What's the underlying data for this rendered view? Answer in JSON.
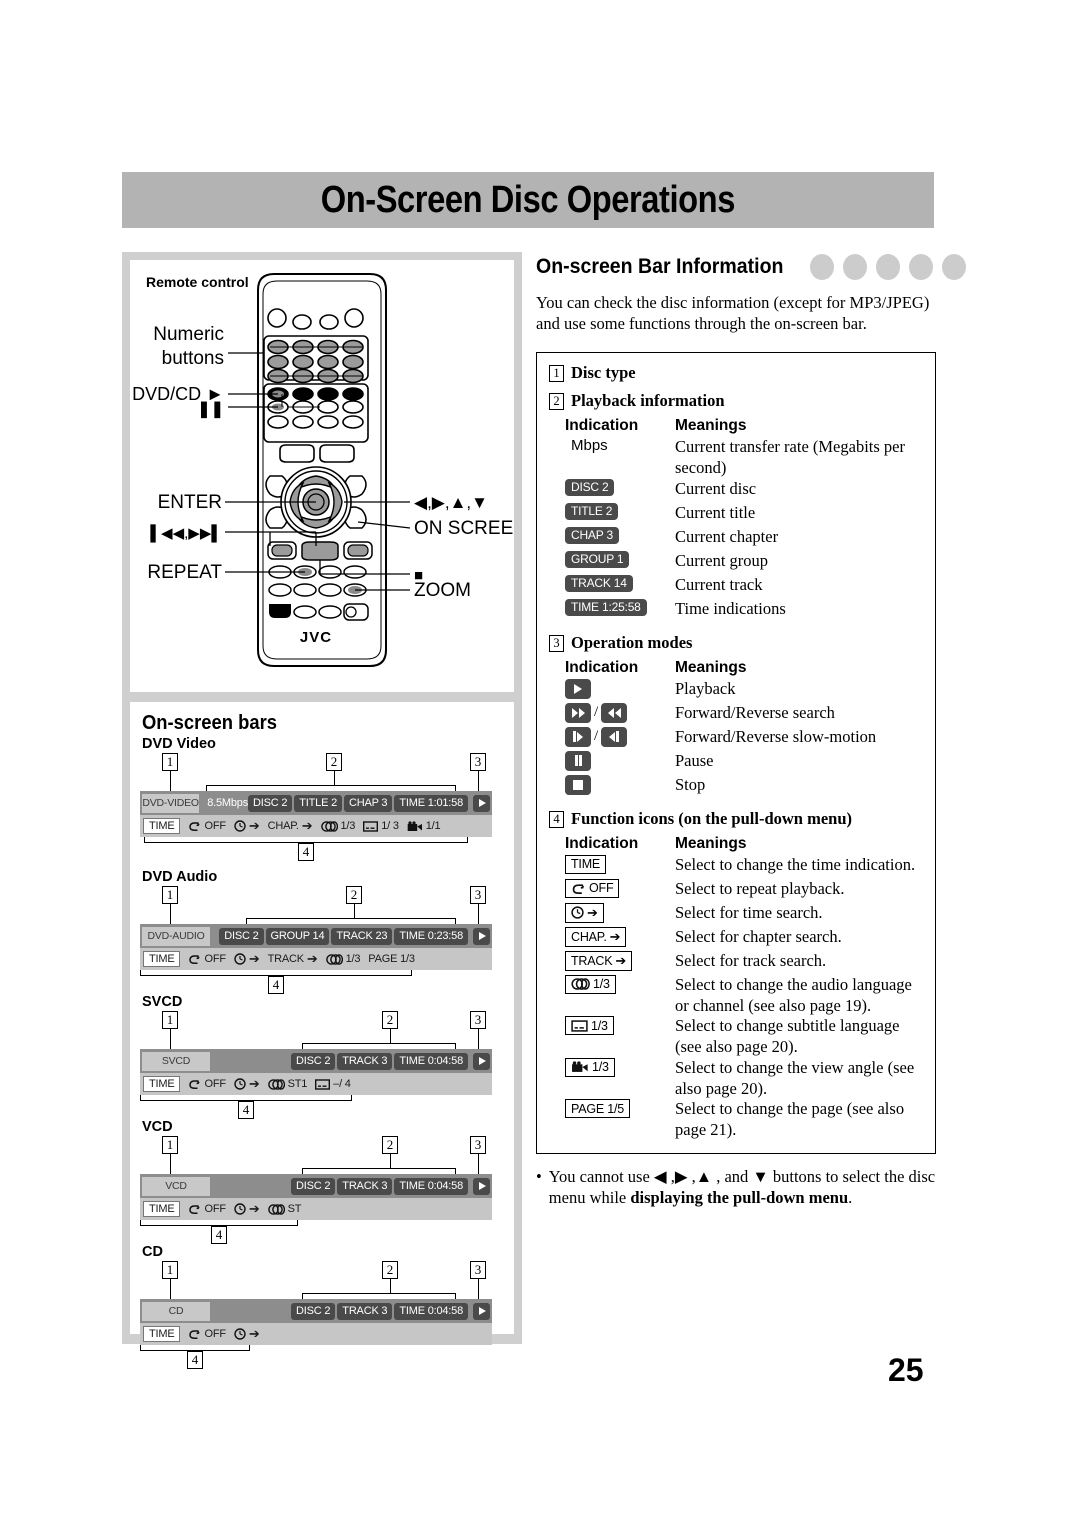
{
  "page": {
    "title": "On-Screen Disc Operations",
    "number": "25"
  },
  "left": {
    "remote": {
      "caption": "Remote control",
      "brand": "JVC",
      "callouts_left": [
        "Numeric",
        "buttons",
        "DVD/CD ▶",
        "❙❙",
        "ENTER",
        "❘◀◀,▶▶❘",
        "REPEAT"
      ],
      "callouts_right": [
        "◀,▶,▲,▼",
        "ON SCREEN",
        "■",
        "ZOOM"
      ]
    },
    "bars_heading": "On-screen bars",
    "bars": [
      {
        "label": "DVD Video",
        "disc_type": "DVD-VIDEO",
        "mbps": "8.5Mbps",
        "playback_chips": [
          "DISC 2",
          "TITLE 2",
          "CHAP 3",
          "TIME   1:01:58"
        ],
        "mode_icon": "play-icon",
        "functions": [
          {
            "icon": "time-icon",
            "text": "TIME",
            "selected": true
          },
          {
            "icon": "repeat-icon",
            "text": "OFF"
          },
          {
            "icon": "clock-arrow-icon",
            "text": ""
          },
          {
            "icon": "chapter-arrow-icon",
            "text": "CHAP."
          },
          {
            "icon": "audio-icon",
            "text": "1/3"
          },
          {
            "icon": "subtitle-icon",
            "text": "1/ 3"
          },
          {
            "icon": "angle-icon",
            "text": "1/1"
          }
        ]
      },
      {
        "label": "DVD Audio",
        "disc_type": "DVD-AUDIO",
        "mbps": "",
        "playback_chips": [
          "DISC 2",
          "GROUP 14",
          "TRACK 23",
          "TIME   0:23:58"
        ],
        "mode_icon": "play-icon",
        "functions": [
          {
            "icon": "time-icon",
            "text": "TIME",
            "selected": true
          },
          {
            "icon": "repeat-icon",
            "text": "OFF"
          },
          {
            "icon": "clock-arrow-icon",
            "text": ""
          },
          {
            "icon": "track-arrow-icon",
            "text": "TRACK"
          },
          {
            "icon": "audio-icon",
            "text": "1/3"
          },
          {
            "icon": "page-icon",
            "text": "PAGE 1/3"
          }
        ]
      },
      {
        "label": "SVCD",
        "disc_type": "SVCD",
        "mbps": "",
        "playback_chips": [
          "DISC 2",
          "TRACK 3",
          "TIME   0:04:58"
        ],
        "mode_icon": "play-icon",
        "functions": [
          {
            "icon": "time-icon",
            "text": "TIME",
            "selected": true
          },
          {
            "icon": "repeat-icon",
            "text": "OFF"
          },
          {
            "icon": "clock-arrow-icon",
            "text": ""
          },
          {
            "icon": "audio-icon",
            "text": "ST1"
          },
          {
            "icon": "subtitle-icon",
            "text": "–/ 4"
          }
        ]
      },
      {
        "label": "VCD",
        "disc_type": "VCD",
        "mbps": "",
        "playback_chips": [
          "DISC 2",
          "TRACK 3",
          "TIME   0:04:58"
        ],
        "mode_icon": "play-icon",
        "functions": [
          {
            "icon": "time-icon",
            "text": "TIME",
            "selected": true
          },
          {
            "icon": "repeat-icon",
            "text": "OFF"
          },
          {
            "icon": "clock-arrow-icon",
            "text": ""
          },
          {
            "icon": "audio-icon",
            "text": "ST"
          }
        ]
      },
      {
        "label": "CD",
        "disc_type": "CD",
        "mbps": "",
        "playback_chips": [
          "DISC 2",
          "TRACK 3",
          "TIME   0:04:58"
        ],
        "mode_icon": "play-icon",
        "functions": [
          {
            "icon": "time-icon",
            "text": "TIME",
            "selected": true
          },
          {
            "icon": "repeat-icon",
            "text": "OFF"
          },
          {
            "icon": "clock-arrow-icon",
            "text": ""
          }
        ]
      }
    ],
    "callout_numbers": {
      "one": "1",
      "two": "2",
      "three": "3",
      "four": "4"
    }
  },
  "right": {
    "heading": "On-screen Bar Information",
    "dots_count": 5,
    "intro": "You can check the disc information (except for MP3/JPEG) and use some functions through the on-screen bar.",
    "sections": [
      {
        "num": "1",
        "title": "Disc type"
      },
      {
        "num": "2",
        "title": "Playback information",
        "col_headers": {
          "indication": "Indication",
          "meanings": "Meanings"
        },
        "rows": [
          {
            "ind_type": "plain",
            "ind": "Mbps",
            "mean": "Current transfer rate (Megabits per second)"
          },
          {
            "ind_type": "chip",
            "ind": "DISC 2",
            "mean": "Current disc"
          },
          {
            "ind_type": "chip",
            "ind": "TITLE  2",
            "mean": "Current title"
          },
          {
            "ind_type": "chip",
            "ind": "CHAP  3",
            "mean": "Current chapter"
          },
          {
            "ind_type": "chip",
            "ind": "GROUP 1",
            "mean": "Current group"
          },
          {
            "ind_type": "chip",
            "ind": "TRACK 14",
            "mean": "Current track"
          },
          {
            "ind_type": "chip",
            "ind": "TIME 1:25:58",
            "mean": "Time indications"
          }
        ]
      },
      {
        "num": "3",
        "title": "Operation modes",
        "col_headers": {
          "indication": "Indication",
          "meanings": "Meanings"
        },
        "rows": [
          {
            "ind_type": "mode",
            "icon": "play-icon",
            "mean": "Playback"
          },
          {
            "ind_type": "mode",
            "icon": "ffwd-rew-icon",
            "mean": "Forward/Reverse search"
          },
          {
            "ind_type": "mode",
            "icon": "slow-fwd-rev-icon",
            "mean": "Forward/Reverse slow-motion"
          },
          {
            "ind_type": "mode",
            "icon": "pause-icon",
            "mean": "Pause"
          },
          {
            "ind_type": "mode",
            "icon": "stop-icon",
            "mean": "Stop"
          }
        ]
      },
      {
        "num": "4",
        "title": "Function icons (on the pull-down menu)",
        "col_headers": {
          "indication": "Indication",
          "meanings": "Meanings"
        },
        "rows": [
          {
            "ind_type": "fnbox",
            "icon": "time-icon",
            "ind": "TIME",
            "mean": "Select to change the time indication."
          },
          {
            "ind_type": "fnbox",
            "icon": "repeat-icon",
            "ind": "OFF",
            "mean": "Select to repeat playback."
          },
          {
            "ind_type": "fnbox",
            "icon": "clock-arrow-icon",
            "ind": "",
            "mean": "Select for time search."
          },
          {
            "ind_type": "fnbox",
            "icon": "arrow-icon",
            "ind": "CHAP.",
            "mean": "Select for chapter search."
          },
          {
            "ind_type": "fnbox",
            "icon": "arrow-icon",
            "ind": "TRACK",
            "mean": "Select for track search."
          },
          {
            "ind_type": "fnbox",
            "icon": "audio-icon",
            "ind": "1/3",
            "mean": "Select to change the audio language or channel (see also page 19)."
          },
          {
            "ind_type": "fnbox",
            "icon": "subtitle-icon",
            "ind": "1/3",
            "mean": "Select to change subtitle language (see also page 20)."
          },
          {
            "ind_type": "fnbox",
            "icon": "angle-icon",
            "ind": "1/3",
            "mean": "Select to change the view angle (see also page 20)."
          },
          {
            "ind_type": "fnbox",
            "icon": "page-icon",
            "ind": "PAGE 1/5",
            "mean": "Select to change the page (see also page 21)."
          }
        ]
      }
    ],
    "note": {
      "bullet": "•",
      "text_before": "You cannot use ◀ ,▶ ,▲ , and ▼ buttons to select the disc menu while ",
      "text_bold": "displaying the pull-down menu",
      "text_after": "."
    }
  }
}
